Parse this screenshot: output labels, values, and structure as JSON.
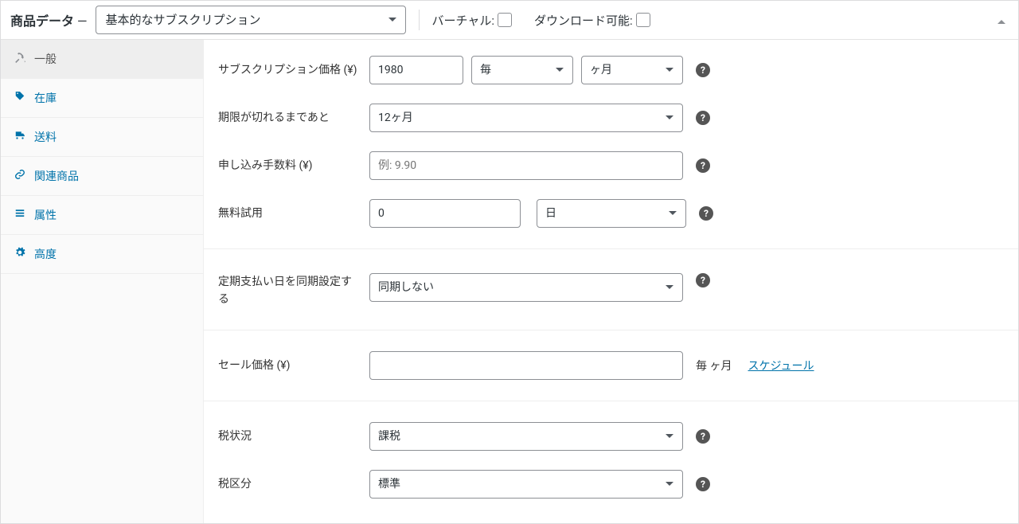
{
  "header": {
    "title": "商品データ",
    "dash": "—",
    "typeSelected": "基本的なサブスクリプション",
    "virtualLabel": "バーチャル:",
    "downloadableLabel": "ダウンロード可能:"
  },
  "sidebar": {
    "items": [
      {
        "label": "一般"
      },
      {
        "label": "在庫"
      },
      {
        "label": "送料"
      },
      {
        "label": "関連商品"
      },
      {
        "label": "属性"
      },
      {
        "label": "高度"
      }
    ]
  },
  "form": {
    "subscriptionPrice": {
      "label": "サブスクリプション価格 (¥)",
      "value": "1980",
      "interval": "毎",
      "period": "ヶ月"
    },
    "expire": {
      "label": "期限が切れるまであと",
      "value": "12ヶ月"
    },
    "signupFee": {
      "label": "申し込み手数料 (¥)",
      "placeholder": "例: 9.90",
      "value": ""
    },
    "freeTrial": {
      "label": "無料試用",
      "value": "0",
      "unit": "日"
    },
    "syncRenewal": {
      "label": "定期支払い日を同期設定する",
      "value": "同期しない"
    },
    "salePrice": {
      "label": "セール価格 (¥)",
      "value": "",
      "suffix": "毎 ヶ月",
      "scheduleLink": "スケジュール"
    },
    "taxStatus": {
      "label": "税状況",
      "value": "課税"
    },
    "taxClass": {
      "label": "税区分",
      "value": "標準"
    }
  }
}
